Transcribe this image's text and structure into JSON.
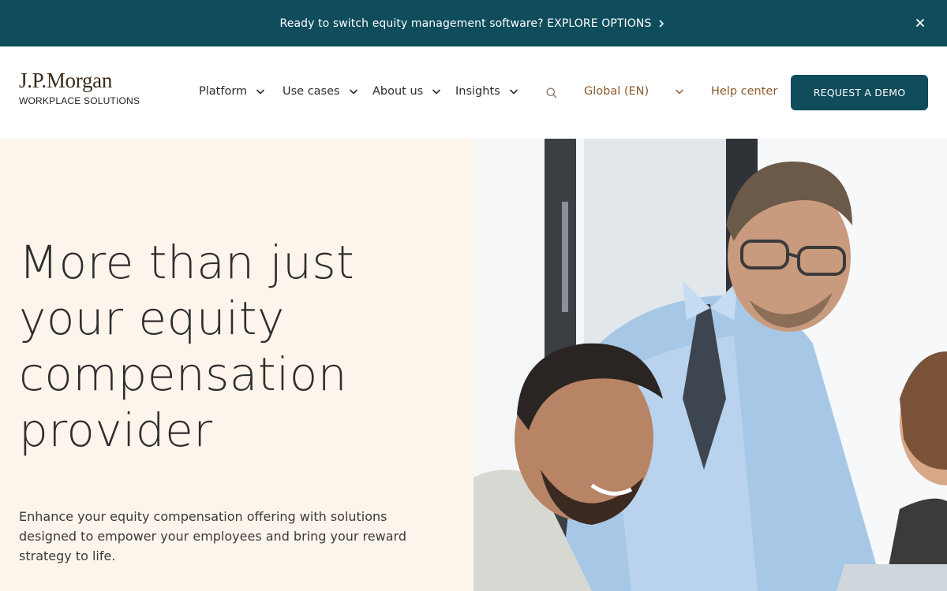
{
  "banner": {
    "text": "Ready to switch equity management software? EXPLORE OPTIONS",
    "close_icon": "close-icon",
    "chevron_icon": "chevron-right-icon"
  },
  "header": {
    "logo_main": "J.P.Morgan",
    "logo_sub": "WORKPLACE SOLUTIONS",
    "nav": [
      {
        "label": "Platform"
      },
      {
        "label": "Use cases"
      },
      {
        "label": "About us"
      },
      {
        "label": "Insights"
      }
    ],
    "search_icon": "search-icon",
    "locale": "Global (EN)",
    "help": "Help center",
    "cta": "REQUEST A DEMO"
  },
  "hero": {
    "title": "More than just your equity compensation provider",
    "subtitle": "Enhance your equity compensation offering with solutions designed to empower your employees and bring your reward strategy to life."
  },
  "colors": {
    "brand": "#0f4c5c",
    "hero_bg": "#fdf5ec",
    "link": "#8a5a2b"
  }
}
